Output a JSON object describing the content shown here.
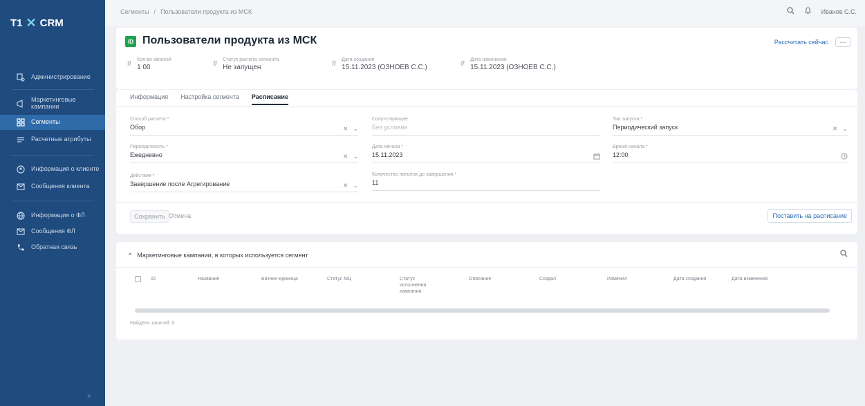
{
  "app": {
    "logo_text": "T1",
    "logo_crm": "CRM"
  },
  "sidebar": {
    "items": [
      {
        "label": "Администрирование",
        "icon": "admin-icon"
      },
      {
        "label": "Маркетинговые кампании",
        "icon": "campaign-icon"
      },
      {
        "label": "Сегменты",
        "icon": "segments-icon",
        "active": true
      },
      {
        "label": "Расчетные атрибуты",
        "icon": "attributes-icon"
      },
      {
        "label": "Информация о клиенте",
        "icon": "client-info-icon"
      },
      {
        "label": "Сообщения клиента",
        "icon": "client-messages-icon"
      },
      {
        "label": "Информация о ФЛ",
        "icon": "globe-icon"
      },
      {
        "label": "Сообщения ФЛ",
        "icon": "messages-icon"
      },
      {
        "label": "Обратная связь",
        "icon": "phone-icon"
      }
    ]
  },
  "topbar": {
    "breadcrumb": [
      "Сегменты",
      "/",
      "Пользователи продукта из МСК"
    ],
    "user": "Иванов С.С."
  },
  "segment": {
    "badge": "ID",
    "title": "Пользователи продукта из МСК",
    "action_label": "Рассчитать сейчас",
    "kebab_label": "···",
    "meta": [
      {
        "label": "Кол-во записей",
        "value": "1 00"
      },
      {
        "label": "Статус расчета сегмента",
        "value": "Не запущен"
      },
      {
        "label": "Дата создания",
        "value": "15.11.2023 (ОЗНОЕВ С.С.)"
      },
      {
        "label": "Дата изменения",
        "value": "15.11.2023 (ОЗНОЕВ С.С.)"
      }
    ]
  },
  "tabs": [
    "Информация",
    "Настройка сегмента",
    "Расписание"
  ],
  "active_tab": 2,
  "form": {
    "calc_type": {
      "label": "Способ расчета *",
      "value": "Обор"
    },
    "periodicity": {
      "label": "Периодичность *",
      "value": "Ежедневно"
    },
    "action": {
      "label": "Действие *",
      "value": "Завершение после Агрегирование"
    },
    "dependency": {
      "label": "Сопутствующее",
      "placeholder": "Без условия"
    },
    "start_date": {
      "label": "Дата начала *",
      "value": "15.11.2023"
    },
    "retries": {
      "label": "Количество попыток до завершения *",
      "value": "11"
    },
    "calc_method": {
      "label": "Тип запуска *",
      "value": "Периодический запуск"
    },
    "start_time": {
      "label": "Время начала *",
      "value": "12:00"
    },
    "save_label": "Сохранить",
    "cancel_label": "Отмена",
    "schedule_label": "Поставить на расписание"
  },
  "campaigns": {
    "title": "Маркетинговые кампании, в которых используется сегмент",
    "columns": [
      "ID",
      "Название",
      "Бизнес-единица",
      "Статус МЦ",
      "Статус исполнения кампании",
      "Описание",
      "Создал",
      "Изменил",
      "Дата создания",
      "Дата изменения"
    ],
    "found_label": "Найдено записей: 0"
  }
}
